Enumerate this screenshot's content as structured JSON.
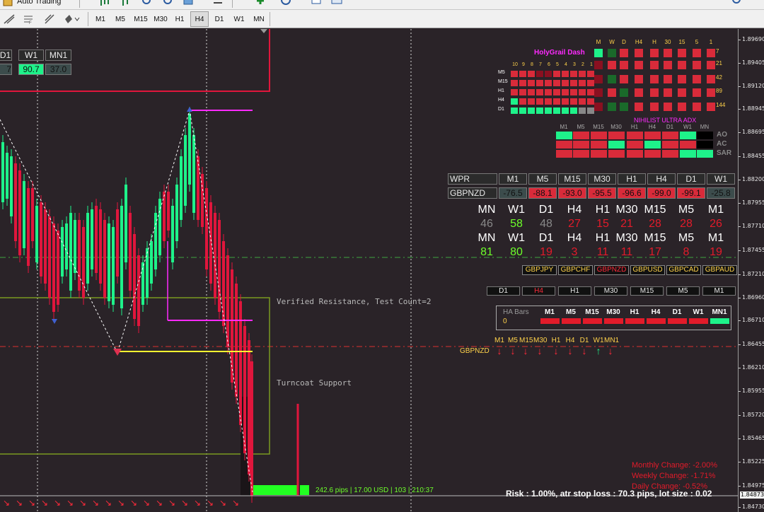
{
  "toolbar": {
    "auto_trading_label": "Auto Trading",
    "timeframes": [
      "M1",
      "M5",
      "M15",
      "M30",
      "H1",
      "H4",
      "D1",
      "W1",
      "MN"
    ],
    "active_timeframe": "H4"
  },
  "price_axis": {
    "labels": [
      "1.89690",
      "1.89405",
      "1.89120",
      "1.88945",
      "1.88695",
      "1.88455",
      "1.88200",
      "1.87955",
      "1.87710",
      "1.87455",
      "1.87210",
      "1.86960",
      "1.86710",
      "1.86455",
      "1.86210",
      "1.85955",
      "1.85720",
      "1.85465",
      "1.85225",
      "1.84975",
      "1.84730"
    ],
    "current_price": "1.84873"
  },
  "chart_labels": {
    "verified_resistance": "Verified Resistance, Test Count=2",
    "turncoat_support": "Turncoat Support",
    "pips_info": "242.6 pips | 17.00 USD | 103 | 210:37"
  },
  "top_left_panel": {
    "headers": [
      "D1",
      "W1",
      "MN1"
    ],
    "values": [
      "7",
      "90.7",
      "37.0"
    ]
  },
  "holygrail": {
    "title": "HolyGrail Dash",
    "top_headers": [
      "M",
      "W",
      "D",
      "H4",
      "H",
      "30",
      "15",
      "5",
      "1"
    ],
    "right_values": [
      "7",
      "21",
      "42",
      "89",
      "144"
    ],
    "num_headers": [
      "10",
      "9",
      "8",
      "7",
      "6",
      "5",
      "4",
      "3",
      "2",
      "1"
    ],
    "row_labels": [
      "M5",
      "M15",
      "H1",
      "H4",
      "D1"
    ]
  },
  "nihilist": {
    "title": "NIHILIST ULTRA ADX",
    "headers": [
      "M1",
      "M5",
      "M15",
      "M30",
      "H1",
      "H4",
      "D1",
      "W1",
      "MN"
    ],
    "row_labels": [
      "AO",
      "AC",
      "SAR"
    ]
  },
  "wpr": {
    "header_label": "WPR",
    "timeframes": [
      "M1",
      "M5",
      "M15",
      "M30",
      "H1",
      "H4",
      "D1",
      "W1"
    ],
    "pair": "GBPNZD",
    "values": [
      "-76.5",
      "-88.1",
      "-93.0",
      "-95.5",
      "-96.6",
      "-99.0",
      "-99.1",
      "-25.8"
    ]
  },
  "strength": {
    "headers1": [
      "MN",
      "W1",
      "D1",
      "H4",
      "H1",
      "M30",
      "M15",
      "M5",
      "M1"
    ],
    "values1": [
      "46",
      "58",
      "48",
      "27",
      "15",
      "21",
      "28",
      "28",
      "26"
    ],
    "headers2": [
      "MN",
      "W1",
      "D1",
      "H4",
      "H1",
      "M30",
      "M15",
      "M5",
      "M1"
    ],
    "values2": [
      "81",
      "80",
      "19",
      "3",
      "11",
      "11",
      "17",
      "8",
      "19"
    ]
  },
  "pairs": [
    "GBPJPY",
    "GBPCHF",
    "GBPNZD",
    "GBPUSD",
    "GBPCAD",
    "GBPAUD"
  ],
  "tf_row": [
    "D1",
    "H4",
    "H1",
    "M30",
    "M15",
    "M5",
    "M1"
  ],
  "ha_bars": {
    "title": "HA Bars",
    "value": "0",
    "headers": [
      "M1",
      "M5",
      "M15",
      "M30",
      "H1",
      "H4",
      "D1",
      "W1",
      "MN1"
    ]
  },
  "arrows_panel": {
    "pair": "GBPNZD",
    "headers": [
      "M1",
      "M5",
      "M15",
      "M30",
      "H1",
      "H4",
      "D1",
      "W1",
      "MN1"
    ]
  },
  "changes": {
    "monthly": "Monthly Change: -2.00%",
    "weekly": "Weekly Change: -1.71%",
    "daily": "Daily Change: -0.52%"
  },
  "risk_text": "Risk : 1.00%, atr stop loss : 70.3 pips, lot size : 0.02"
}
